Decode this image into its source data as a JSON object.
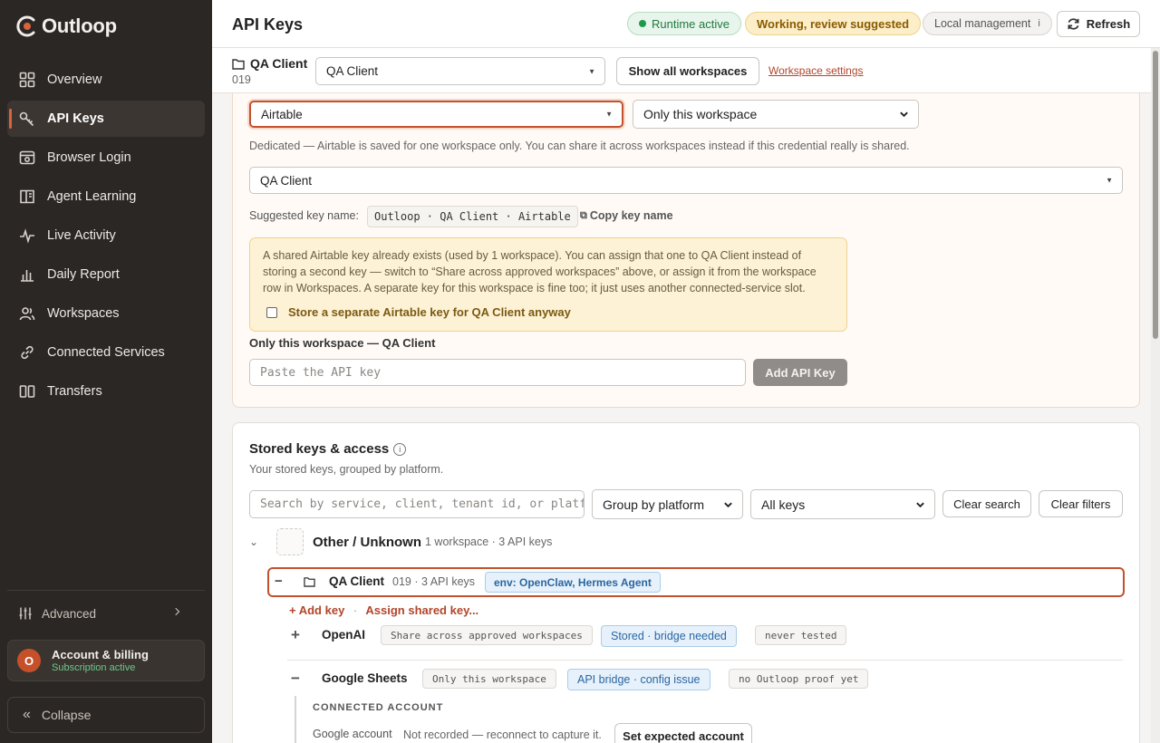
{
  "app": {
    "name": "Outloop"
  },
  "sidebar": {
    "items": [
      {
        "label": "Overview",
        "icon": "grid-icon"
      },
      {
        "label": "API Keys",
        "icon": "key-icon",
        "active": true
      },
      {
        "label": "Browser Login",
        "icon": "browser-icon"
      },
      {
        "label": "Agent Learning",
        "icon": "book-icon"
      },
      {
        "label": "Live Activity",
        "icon": "pulse-icon"
      },
      {
        "label": "Daily Report",
        "icon": "bar-chart-icon"
      },
      {
        "label": "Workspaces",
        "icon": "users-icon"
      },
      {
        "label": "Connected Services",
        "icon": "link-icon"
      },
      {
        "label": "Transfers",
        "icon": "columns-icon"
      }
    ],
    "advanced_label": "Advanced",
    "account": {
      "initial": "O",
      "title": "Account & billing",
      "status": "Subscription active"
    },
    "collapse_label": "Collapse"
  },
  "header": {
    "title": "API Keys",
    "runtime_badge": "Runtime active",
    "working_badge": "Working, review suggested",
    "local_badge": "Local management",
    "local_info": "i",
    "refresh_label": "Refresh"
  },
  "workspace_bar": {
    "name": "QA Client",
    "id": "019",
    "selected": "QA Client",
    "show_all_label": "Show all workspaces",
    "settings_link": "Workspace settings"
  },
  "add_form": {
    "service_value": "Airtable",
    "scope_value": "Only this workspace",
    "scope_helper": "Dedicated — Airtable is saved for one workspace only. You can share it across workspaces instead if this credential really is shared.",
    "workspace_value": "QA Client",
    "suggested_label": "Suggested key name:",
    "suggested_name": "Outloop · QA Client · Airtable",
    "copy_label": "Copy key name",
    "warning_text": "A shared Airtable key already exists (used by 1 workspace). You can assign that one to QA Client instead of storing a second key — switch to “Share across approved workspaces” above, or assign it from the workspace row in Workspaces. A separate key for this workspace is fine too; it just uses another connected-service slot.",
    "warning_checkbox": "Store a separate Airtable key for QA Client anyway",
    "section_label": "Only this workspace — QA Client",
    "key_placeholder": "Paste the API key",
    "add_button": "Add API Key"
  },
  "stored": {
    "title": "Stored keys & access",
    "info": "i",
    "subtitle": "Your stored keys, grouped by platform.",
    "search_placeholder": "Search by service, client, tenant id, or platform",
    "group_by": "Group by platform",
    "filter": "All keys",
    "clear_search": "Clear search",
    "clear_filters": "Clear filters",
    "group": {
      "chevron": "⌄",
      "name": "Other / Unknown",
      "meta": "1 workspace · 3 API keys"
    },
    "workspace_row": {
      "toggle": "−",
      "name": "QA Client",
      "meta": "019 · 3 API keys",
      "env": "env: OpenClaw, Hermes Agent"
    },
    "add_key": "+ Add key",
    "separator": "·",
    "assign_shared": "Assign shared key...",
    "services": [
      {
        "toggle": "+",
        "name": "OpenAI",
        "scope": "Share across approved workspaces",
        "status": "Stored · bridge needed",
        "test": "never tested"
      },
      {
        "toggle": "−",
        "name": "Google Sheets",
        "scope": "Only this workspace",
        "status": "API bridge · config issue",
        "test": "no Outloop proof yet"
      }
    ],
    "connected": {
      "heading": "CONNECTED ACCOUNT",
      "label": "Google account",
      "value": "Not recorded — reconnect to capture it.",
      "button": "Set expected account"
    }
  },
  "colors": {
    "accent": "#c2522e",
    "sidebar_bg": "#2b2724",
    "success": "#1f9a48",
    "info_blue": "#2b67a0"
  }
}
